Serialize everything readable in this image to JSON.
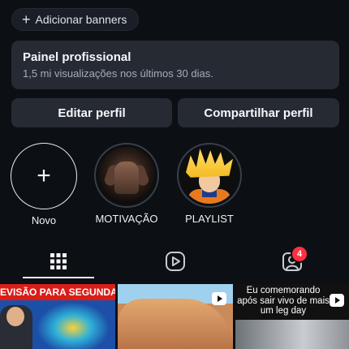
{
  "banner_button": {
    "label": "Adicionar banners",
    "icon": "plus-icon"
  },
  "pro_panel": {
    "title": "Painel profissional",
    "subtitle": "1,5 mi visualizações nos últimos 30 dias."
  },
  "actions": {
    "edit_label": "Editar perfil",
    "share_label": "Compartilhar perfil"
  },
  "highlights": [
    {
      "label": "Novo",
      "icon": "plus-icon"
    },
    {
      "label": "MOTIVAÇÃO"
    },
    {
      "label": "PLAYLIST"
    }
  ],
  "tabs": {
    "grid_icon": "grid-icon",
    "reels_icon": "reels-icon",
    "tagged_icon": "tagged-user-icon",
    "tagged_badge": "4",
    "active": "grid"
  },
  "posts": [
    {
      "caption": "EVISÃO PARA SEGUNDA-"
    },
    {
      "caption": ""
    },
    {
      "caption": "Eu comemorando após sair vivo de mais um leg day"
    }
  ],
  "colors": {
    "background": "#0c0f14",
    "card": "#262a33",
    "badge": "#ff3040"
  }
}
